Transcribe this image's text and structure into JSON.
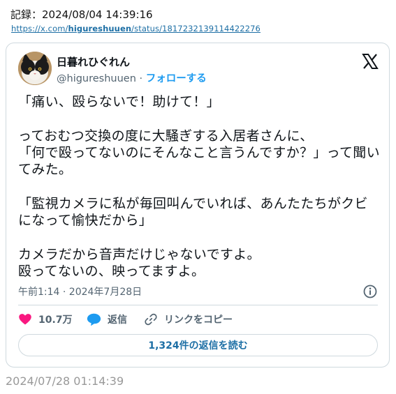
{
  "record_label": "記録：2024/08/04 14:39:16",
  "source_url": {
    "prefix": "https://x.com/",
    "handle": "higureshuuen",
    "suffix": "/status/1817232139114422276"
  },
  "tweet": {
    "display_name": "日暮れひぐれん",
    "handle": "@higureshuuen",
    "separator": " · ",
    "follow_label": "フォローする",
    "body": "「痛い、殴らないで！助けて！」\n\nっておむつ交換の度に大騒ぎする入居者さんに、\n「何で殴ってないのにそんなこと言うんですか？」って聞いてみた。\n\n「監視カメラに私が毎回叫んでいれば、あんたたちがクビになって愉快だから」\n\nカメラだから音声だけじゃないですよ。\n殴ってないの、映ってますよ。",
    "timestamp": "午前1:14 · 2024年7月28日",
    "like_count": "10.7万",
    "reply_label": "返信",
    "copy_link_label": "リンクをコピー",
    "read_replies_label": "1,324件の返信を読む"
  },
  "footer_date": "2024/07/28 01:14:39",
  "colors": {
    "accent": "#1d9bf0",
    "like": "#f91880",
    "muted": "#536471",
    "border": "#cfd9de"
  },
  "icons": [
    "x-logo-icon",
    "info-icon",
    "heart-icon",
    "reply-bubble-icon",
    "link-icon"
  ]
}
